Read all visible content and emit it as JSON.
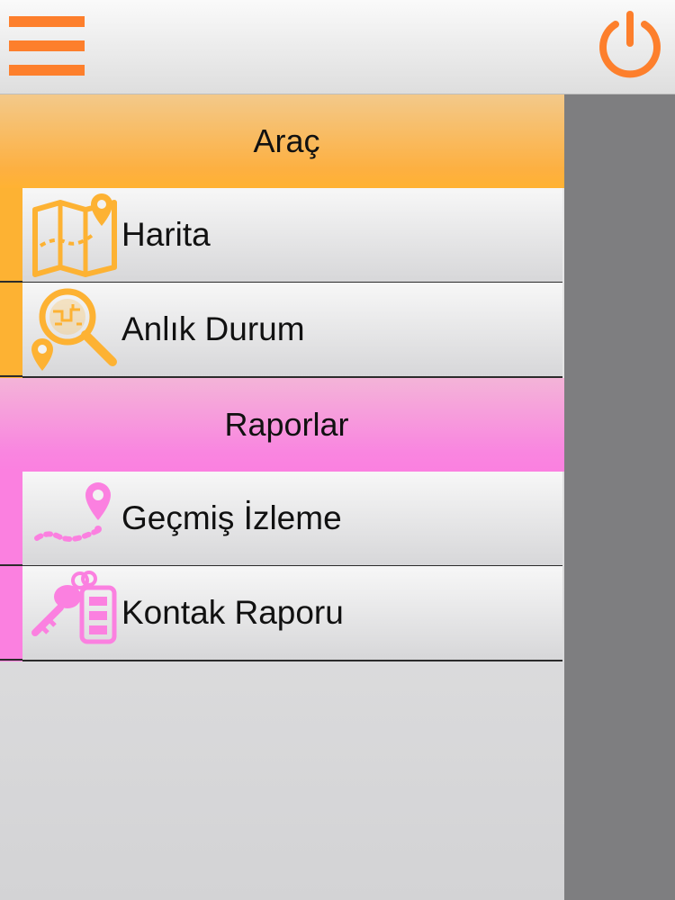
{
  "toolbar": {
    "menu_icon": "hamburger-menu-icon",
    "power_icon": "power-icon",
    "accent_color": "#fd7f2c"
  },
  "menu": {
    "sections": [
      {
        "title": "Araç",
        "color": "#fdb233",
        "items": [
          {
            "label": "Harita",
            "icon": "map-pin-icon"
          },
          {
            "label": "Anlık Durum",
            "icon": "search-location-icon"
          }
        ]
      },
      {
        "title": "Raporlar",
        "color": "#fb80e0",
        "items": [
          {
            "label": "Geçmiş İzleme",
            "icon": "route-history-icon"
          },
          {
            "label": "Kontak Raporu",
            "icon": "car-key-icon"
          }
        ]
      }
    ]
  }
}
